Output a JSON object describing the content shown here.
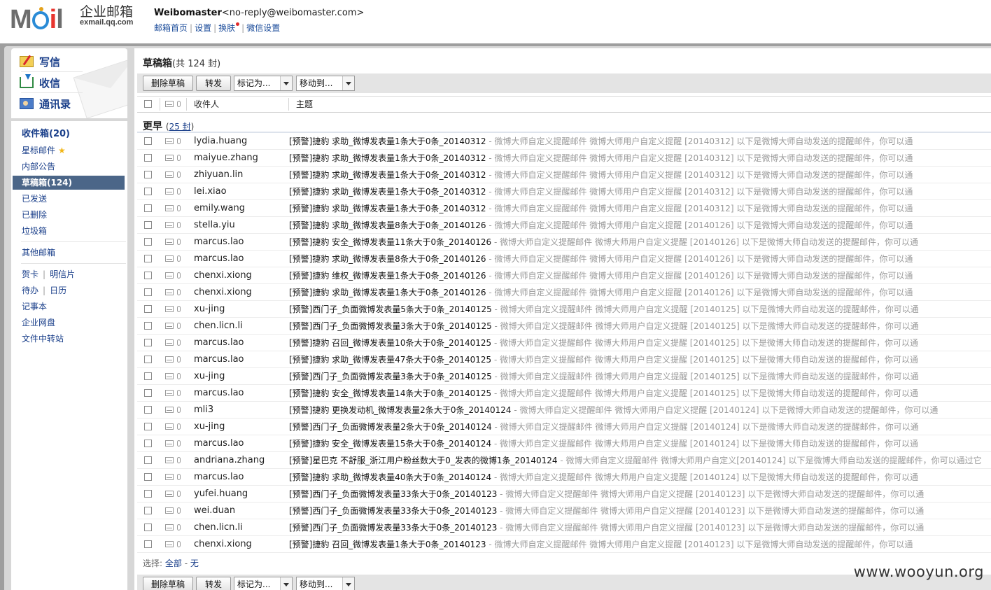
{
  "brand": {
    "logo_text": "MOil",
    "name_cn": "企业邮箱",
    "domain": "exmail.qq.com"
  },
  "user": {
    "name": "Weibomaster",
    "email": "<no-reply@weibomaster.com>"
  },
  "top_links": {
    "home": "邮箱首页",
    "settings": "设置",
    "skin": "换肤",
    "wechat": "微信设置"
  },
  "quick_actions": {
    "write": "写信",
    "receive": "收信",
    "contacts": "通讯录"
  },
  "sidebar": {
    "inbox": "收件箱(20)",
    "starred": "星标邮件",
    "announcements": "内部公告",
    "drafts": "草稿箱(124)",
    "sent": "已发送",
    "deleted": "已删除",
    "trash": "垃圾箱",
    "other_mailbox": "其他邮箱",
    "greeting_card": "贺卡",
    "postcard": "明信片",
    "todo": "待办",
    "calendar": "日历",
    "notes": "记事本",
    "netdisk": "企业网盘",
    "file_transfer": "文件中转站"
  },
  "folder": {
    "title": "草稿箱",
    "count_text": "(共 124 封)"
  },
  "toolbar": {
    "delete_draft": "删除草稿",
    "forward": "转发",
    "mark_as": "标记为...",
    "move_to": "移动到..."
  },
  "columns": {
    "recipient": "收件人",
    "subject": "主题"
  },
  "group": {
    "label": "更早",
    "open_paren": "(",
    "count": "25 封",
    "close_paren": ")"
  },
  "emails": [
    {
      "to": "lydia.huang",
      "subject": "[预警]捷豹 求助_微博发表量1条大于0条_20140312",
      "summary": " - 微博大师自定义提醒邮件 微博大师用户自定义提醒 [20140312] 以下是微博大师自动发送的提醒邮件，你可以通"
    },
    {
      "to": "maiyue.zhang",
      "subject": "[预警]捷豹 求助_微博发表量1条大于0条_20140312",
      "summary": " - 微博大师自定义提醒邮件 微博大师用户自定义提醒 [20140312] 以下是微博大师自动发送的提醒邮件，你可以通"
    },
    {
      "to": "zhiyuan.lin",
      "subject": "[预警]捷豹 求助_微博发表量1条大于0条_20140312",
      "summary": " - 微博大师自定义提醒邮件 微博大师用户自定义提醒 [20140312] 以下是微博大师自动发送的提醒邮件，你可以通"
    },
    {
      "to": "lei.xiao",
      "subject": "[预警]捷豹 求助_微博发表量1条大于0条_20140312",
      "summary": " - 微博大师自定义提醒邮件 微博大师用户自定义提醒 [20140312] 以下是微博大师自动发送的提醒邮件，你可以通"
    },
    {
      "to": "emily.wang",
      "subject": "[预警]捷豹 求助_微博发表量1条大于0条_20140312",
      "summary": " - 微博大师自定义提醒邮件 微博大师用户自定义提醒 [20140312] 以下是微博大师自动发送的提醒邮件，你可以通"
    },
    {
      "to": "stella.yiu",
      "subject": "[预警]捷豹 求助_微博发表量8条大于0条_20140126",
      "summary": " - 微博大师自定义提醒邮件 微博大师用户自定义提醒 [20140126] 以下是微博大师自动发送的提醒邮件，你可以通"
    },
    {
      "to": "marcus.lao",
      "subject": "[预警]捷豹 安全_微博发表量11条大于0条_20140126",
      "summary": " - 微博大师自定义提醒邮件 微博大师用户自定义提醒 [20140126] 以下是微博大师自动发送的提醒邮件，你可以通"
    },
    {
      "to": "marcus.lao",
      "subject": "[预警]捷豹 求助_微博发表量8条大于0条_20140126",
      "summary": " - 微博大师自定义提醒邮件 微博大师用户自定义提醒 [20140126] 以下是微博大师自动发送的提醒邮件，你可以通"
    },
    {
      "to": "chenxi.xiong",
      "subject": "[预警]捷豹 维权_微博发表量1条大于0条_20140126",
      "summary": " - 微博大师自定义提醒邮件 微博大师用户自定义提醒 [20140126] 以下是微博大师自动发送的提醒邮件，你可以通"
    },
    {
      "to": "chenxi.xiong",
      "subject": "[预警]捷豹 求助_微博发表量1条大于0条_20140126",
      "summary": " - 微博大师自定义提醒邮件 微博大师用户自定义提醒 [20140126] 以下是微博大师自动发送的提醒邮件，你可以通"
    },
    {
      "to": "xu-jing",
      "subject": "[预警]西门子_负面微博发表量5条大于0条_20140125",
      "summary": " - 微博大师自定义提醒邮件 微博大师用户自定义提醒 [20140125] 以下是微博大师自动发送的提醒邮件，你可以通"
    },
    {
      "to": "chen.licn.li",
      "subject": "[预警]西门子_负面微博发表量3条大于0条_20140125",
      "summary": " - 微博大师自定义提醒邮件 微博大师用户自定义提醒 [20140125] 以下是微博大师自动发送的提醒邮件，你可以通"
    },
    {
      "to": "marcus.lao",
      "subject": "[预警]捷豹 召回_微博发表量10条大于0条_20140125",
      "summary": " - 微博大师自定义提醒邮件 微博大师用户自定义提醒 [20140125] 以下是微博大师自动发送的提醒邮件，你可以通"
    },
    {
      "to": "marcus.lao",
      "subject": "[预警]捷豹 求助_微博发表量47条大于0条_20140125",
      "summary": " - 微博大师自定义提醒邮件 微博大师用户自定义提醒 [20140125] 以下是微博大师自动发送的提醒邮件，你可以通"
    },
    {
      "to": "xu-jing",
      "subject": "[预警]西门子_负面微博发表量3条大于0条_20140125",
      "summary": " - 微博大师自定义提醒邮件 微博大师用户自定义提醒 [20140125] 以下是微博大师自动发送的提醒邮件，你可以通"
    },
    {
      "to": "marcus.lao",
      "subject": "[预警]捷豹 安全_微博发表量14条大于0条_20140125",
      "summary": " - 微博大师自定义提醒邮件 微博大师用户自定义提醒 [20140125] 以下是微博大师自动发送的提醒邮件，你可以通"
    },
    {
      "to": "mli3",
      "subject": "[预警]捷豹 更换发动机_微博发表量2条大于0条_20140124",
      "summary": " - 微博大师自定义提醒邮件 微博大师用户自定义提醒 [20140124] 以下是微博大师自动发送的提醒邮件，你可以通"
    },
    {
      "to": "xu-jing",
      "subject": "[预警]西门子_负面微博发表量2条大于0条_20140124",
      "summary": " - 微博大师自定义提醒邮件 微博大师用户自定义提醒 [20140124] 以下是微博大师自动发送的提醒邮件，你可以通"
    },
    {
      "to": "marcus.lao",
      "subject": "[预警]捷豹 安全_微博发表量15条大于0条_20140124",
      "summary": " - 微博大师自定义提醒邮件 微博大师用户自定义提醒 [20140124] 以下是微博大师自动发送的提醒邮件，你可以通"
    },
    {
      "to": "andriana.zhang",
      "subject": "[预警]星巴克 不舒服_浙江用户粉丝数大于0_发表的微博1条_20140124",
      "summary": " - 微博大师自定义提醒邮件 微博大师用户自定义[20140124] 以下是微博大师自动发送的提醒邮件，你可以通过它"
    },
    {
      "to": "marcus.lao",
      "subject": "[预警]捷豹 求助_微博发表量40条大于0条_20140124",
      "summary": " - 微博大师自定义提醒邮件 微博大师用户自定义提醒 [20140124] 以下是微博大师自动发送的提醒邮件，你可以通"
    },
    {
      "to": "yufei.huang",
      "subject": "[预警]西门子_负面微博发表量33条大于0条_20140123",
      "summary": " - 微博大师自定义提醒邮件 微博大师用户自定义提醒 [20140123] 以下是微博大师自动发送的提醒邮件，你可以通"
    },
    {
      "to": "wei.duan",
      "subject": "[预警]西门子_负面微博发表量33条大于0条_20140123",
      "summary": " - 微博大师自定义提醒邮件 微博大师用户自定义提醒 [20140123] 以下是微博大师自动发送的提醒邮件，你可以通"
    },
    {
      "to": "chen.licn.li",
      "subject": "[预警]西门子_负面微博发表量33条大于0条_20140123",
      "summary": " - 微博大师自定义提醒邮件 微博大师用户自定义提醒 [20140123] 以下是微博大师自动发送的提醒邮件，你可以通"
    },
    {
      "to": "chenxi.xiong",
      "subject": "[预警]捷豹 召回_微博发表量1条大于0条_20140123",
      "summary": " - 微博大师自定义提醒邮件 微博大师用户自定义提醒 [20140123] 以下是微博大师自动发送的提醒邮件，你可以通"
    }
  ],
  "select_bar": {
    "label": "选择:",
    "all": "全部",
    "dash": " - ",
    "none": "无"
  },
  "watermark": "www.wooyun.org"
}
